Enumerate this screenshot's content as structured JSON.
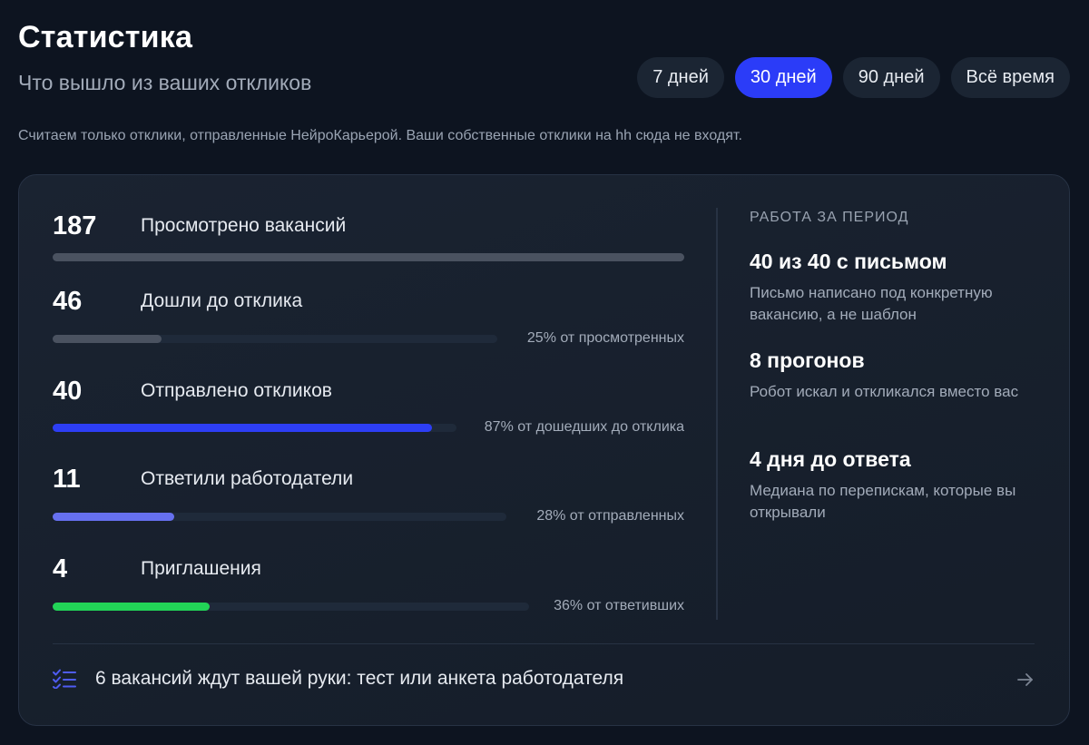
{
  "header": {
    "title": "Статистика",
    "subtitle": "Что вышло из ваших откликов",
    "note": "Считаем только отклики, отправленные НейроКарьерой. Ваши собственные отклики на hh сюда не входят."
  },
  "periods": [
    {
      "label": "7 дней",
      "active": false
    },
    {
      "label": "30 дней",
      "active": true
    },
    {
      "label": "90 дней",
      "active": false
    },
    {
      "label": "Всё время",
      "active": false
    }
  ],
  "funnel": [
    {
      "value": "187",
      "label": "Просмотрено вакансий",
      "percent_text": "",
      "fill_fraction": 1.0,
      "fill_color": "#4a5260"
    },
    {
      "value": "46",
      "label": "Дошли до отклика",
      "percent_text": "25% от просмотренных",
      "fill_fraction": 0.25,
      "fill_color": "#4a5260"
    },
    {
      "value": "40",
      "label": "Отправлено откликов",
      "percent_text": "87% от дошедших до отклика",
      "fill_fraction": 0.87,
      "fill_color": "#2d3ef5"
    },
    {
      "value": "11",
      "label": "Ответили работодатели",
      "percent_text": "28% от отправленных",
      "fill_fraction": 0.28,
      "fill_color": "#6670ef"
    },
    {
      "value": "4",
      "label": "Приглашения",
      "percent_text": "36% от ответивших",
      "fill_fraction": 0.36,
      "fill_color": "#22d457"
    }
  ],
  "side": {
    "heading": "РАБОТА ЗА ПЕРИОД",
    "stats": [
      {
        "title": "40 из 40 с письмом",
        "desc": "Письмо написано под конкретную вакансию, а не шаблон"
      },
      {
        "title": "8 прогонов",
        "desc": "Робот искал и откликался вместо вас"
      },
      {
        "title": "4 дня до ответа",
        "desc": "Медиана по перепискам, которые вы открывали"
      }
    ]
  },
  "task": {
    "text": "6 вакансий ждут вашей руки: тест или анкета работодателя",
    "icon": "checklist-icon",
    "arrow_icon": "arrow-right-icon"
  },
  "colors": {
    "accent": "#2b3cf8",
    "background": "#0d1420",
    "card": "#171f2c",
    "green": "#22d457"
  }
}
